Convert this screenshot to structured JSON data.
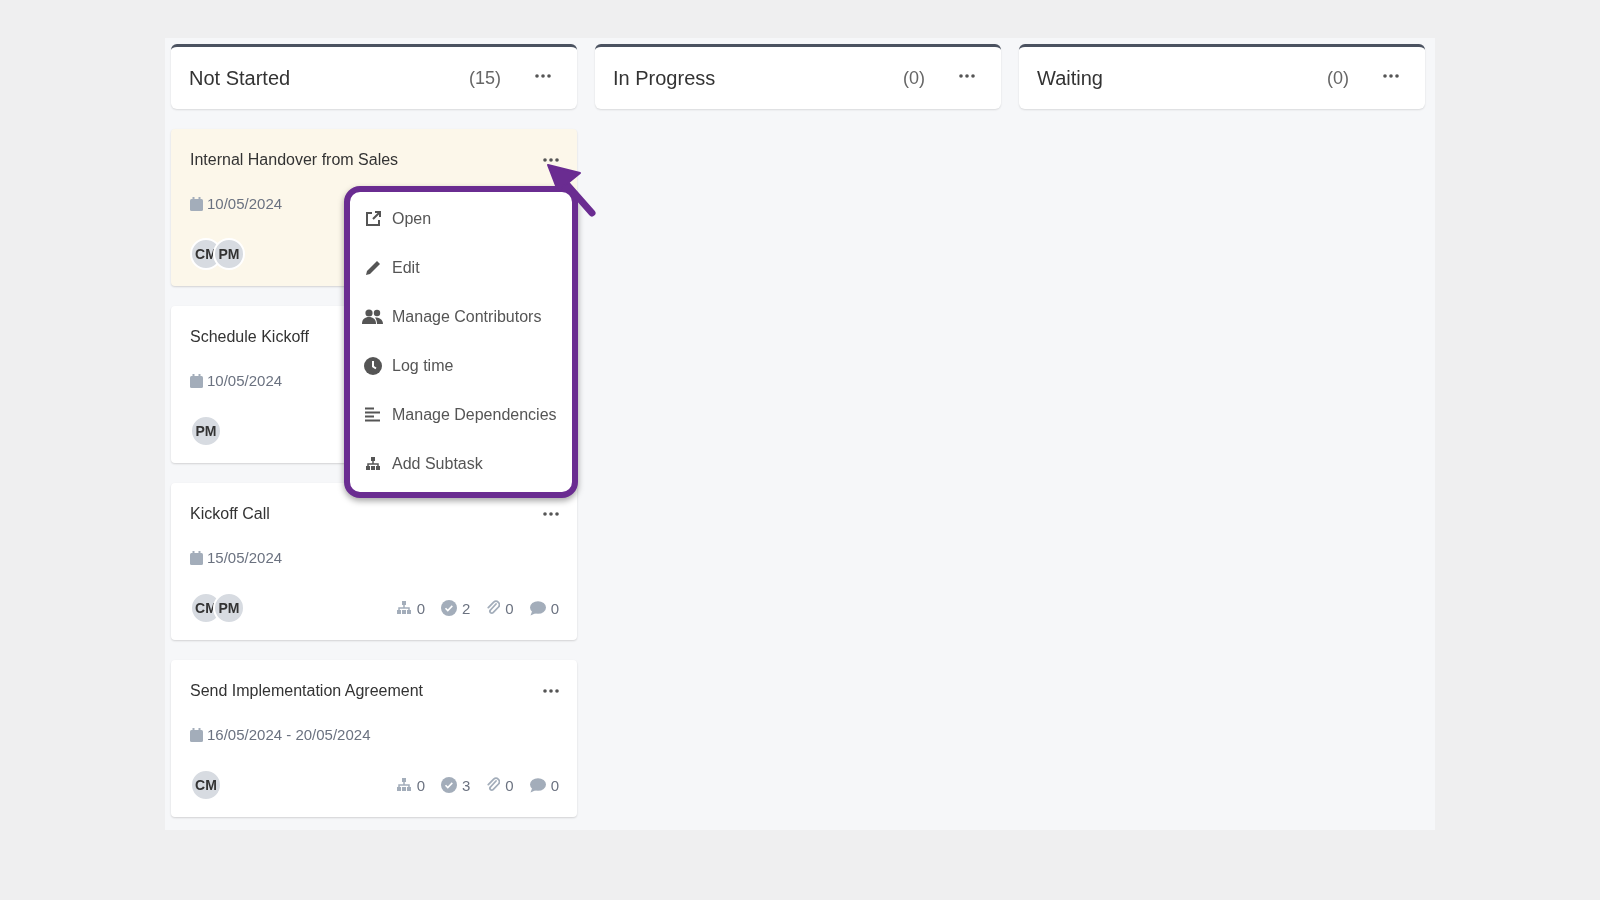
{
  "columns": [
    {
      "title": "Not Started",
      "count": "(15)",
      "cards": [
        {
          "title": "Internal Handover from Sales",
          "date": "10/05/2024",
          "highlighted": true,
          "avatars": [
            "CM",
            "PM"
          ]
        },
        {
          "title": "Schedule Kickoff",
          "date": "10/05/2024",
          "highlighted": false,
          "avatars": [
            "PM"
          ]
        },
        {
          "title": "Kickoff Call",
          "date": "15/05/2024",
          "highlighted": false,
          "avatars": [
            "CM",
            "PM"
          ],
          "stats": [
            {
              "kind": "subtasks",
              "value": "0"
            },
            {
              "kind": "checks",
              "value": "2"
            },
            {
              "kind": "attachments",
              "value": "0"
            },
            {
              "kind": "comments",
              "value": "0"
            }
          ]
        },
        {
          "title": "Send Implementation Agreement",
          "date": "16/05/2024 - 20/05/2024",
          "highlighted": false,
          "avatars": [
            "CM"
          ],
          "stats": [
            {
              "kind": "subtasks",
              "value": "0"
            },
            {
              "kind": "checks",
              "value": "3"
            },
            {
              "kind": "attachments",
              "value": "0"
            },
            {
              "kind": "comments",
              "value": "0"
            }
          ]
        }
      ]
    },
    {
      "title": "In Progress",
      "count": "(0)"
    },
    {
      "title": "Waiting",
      "count": "(0)"
    }
  ],
  "context_menu": {
    "items": [
      {
        "kind": "open",
        "label": "Open"
      },
      {
        "kind": "edit",
        "label": "Edit"
      },
      {
        "kind": "contributors",
        "label": "Manage Contributors"
      },
      {
        "kind": "time",
        "label": "Log time"
      },
      {
        "kind": "dependencies",
        "label": "Manage Dependencies"
      },
      {
        "kind": "subtask",
        "label": "Add Subtask"
      }
    ]
  }
}
